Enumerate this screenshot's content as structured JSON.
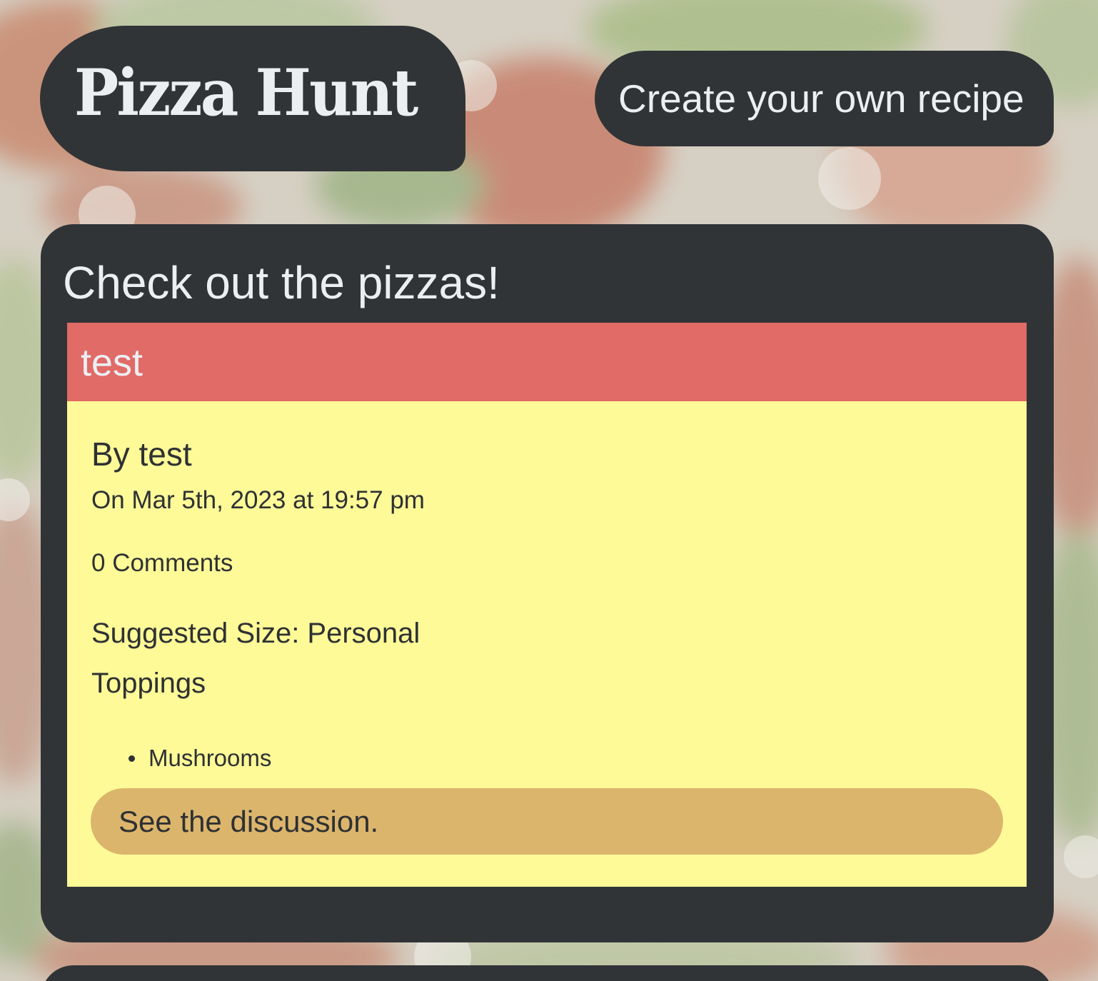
{
  "header": {
    "logo_text": "Pizza Hunt",
    "create_button_label": "Create your own recipe"
  },
  "main": {
    "section_title": "Check out the pizzas!",
    "pizzas": [
      {
        "name": "test",
        "author_line": "By test",
        "date_line": "On Mar 5th, 2023 at 19:57 pm",
        "comments_line": "0 Comments",
        "size_line": "Suggested Size: Personal",
        "toppings_label": "Toppings",
        "toppings": [
          "Mushrooms"
        ],
        "discussion_link": "See the discussion."
      }
    ]
  },
  "colors": {
    "panel": "#313437",
    "card_header": "#e06b67",
    "card_body": "#fffa98",
    "discussion_button": "#dcb56d",
    "light_text": "#eceff2",
    "dark_text": "#2e3133"
  }
}
